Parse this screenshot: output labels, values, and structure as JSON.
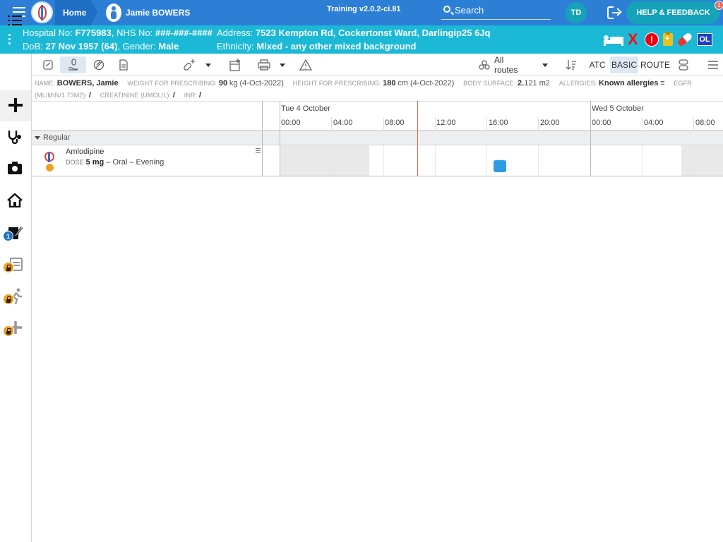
{
  "topbar": {
    "home_label": "Home",
    "patient_name": "Jamie BOWERS",
    "version": "Training v2.0.2-ci.81",
    "search_label": "Search",
    "user_initials": "TD",
    "help_label": "HELP & FEEDBACK",
    "help_badge": "1"
  },
  "banner": {
    "hospital_no_label": "Hospital No:",
    "hospital_no": "F775983",
    "nhs_no_label": "NHS No:",
    "nhs_no": "###-###-####",
    "dob_label": "DoB:",
    "dob": "27 Nov 1957 (64)",
    "gender_label": "Gender:",
    "gender": "Male",
    "address_label": "Address:",
    "address": "7523 Kempton Rd, Cockertonst Ward, Darlingip25 6Jq",
    "ethnicity_label": "Ethnicity:",
    "ethnicity": "Mixed - any other mixed background",
    "icon_x": "X",
    "icon_warn": "!",
    "icon_ol": "OL"
  },
  "sidebar": {
    "badge_count": "1"
  },
  "toolbar": {
    "routes_label": "All routes",
    "atc_label": "ATC",
    "basic_label": "BASIC",
    "route_label": "ROUTE"
  },
  "info": {
    "name_key": "Name:",
    "name_val": "BOWERS, Jamie",
    "weight_key": "Weight for prescribing:",
    "weight_val": "90",
    "weight_unit": "kg (4-Oct-2022)",
    "height_key": "Height for prescribing:",
    "height_val": "180",
    "height_unit": "cm (4-Oct-2022)",
    "bsa_key": "Body surface:",
    "bsa_val": "2.",
    "bsa_unit": "121 m2",
    "allergies_key": "Allergies:",
    "allergies_val": "Known allergies",
    "egfr_key": "eGFR",
    "egfr_unit_key": "(mL/min/1.73m2):",
    "egfr_val": "/",
    "creat_key": "Creatinine (umol/L):",
    "creat_val": "/",
    "inr_key": "INR:",
    "inr_val": "/"
  },
  "timeline": {
    "day1": "Tue 4 October",
    "day2": "Wed 5 October",
    "hours": [
      "00:00",
      "04:00",
      "08:00",
      "12:00",
      "16:00",
      "20:00",
      "00:00",
      "04:00",
      "08:00"
    ],
    "group_label": "Regular"
  },
  "medication": {
    "name": "Amlodipine",
    "dose_key": "Dose",
    "dose_val": "5 mg",
    "dose_rest": "– Oral – Evening",
    "block_color": "#2f9be6"
  },
  "colors": {
    "topbar": "#2d7fd6",
    "banner": "#1bb9d6",
    "accent_teal": "#16a2b8",
    "now_line": "#e0684f"
  }
}
